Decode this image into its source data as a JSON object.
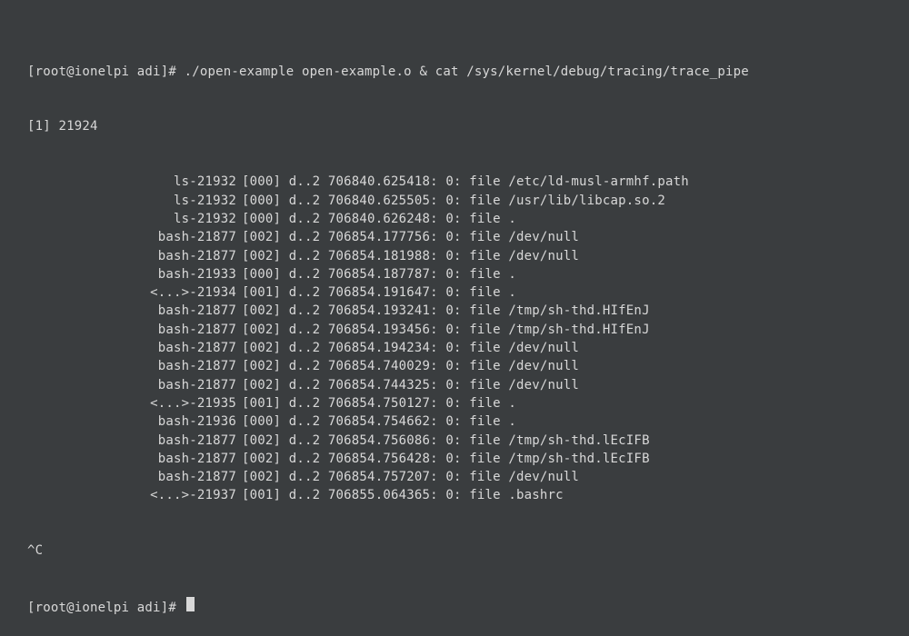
{
  "prompt1": {
    "prefix": "[root@ionelpi adi]# ",
    "cmd": "./open-example open-example.o & cat /sys/kernel/debug/tracing/trace_pipe"
  },
  "job": "[1] 21924",
  "trace": [
    {
      "proc": "ls-21932",
      "cpu": "[000]",
      "flags": "d..2",
      "ts": "706840.625418:",
      "idx": "0:",
      "label": "file",
      "path": "/etc/ld-musl-armhf.path"
    },
    {
      "proc": "ls-21932",
      "cpu": "[000]",
      "flags": "d..2",
      "ts": "706840.625505:",
      "idx": "0:",
      "label": "file",
      "path": "/usr/lib/libcap.so.2"
    },
    {
      "proc": "ls-21932",
      "cpu": "[000]",
      "flags": "d..2",
      "ts": "706840.626248:",
      "idx": "0:",
      "label": "file",
      "path": "."
    },
    {
      "proc": "bash-21877",
      "cpu": "[002]",
      "flags": "d..2",
      "ts": "706854.177756:",
      "idx": "0:",
      "label": "file",
      "path": "/dev/null"
    },
    {
      "proc": "bash-21877",
      "cpu": "[002]",
      "flags": "d..2",
      "ts": "706854.181988:",
      "idx": "0:",
      "label": "file",
      "path": "/dev/null"
    },
    {
      "proc": "bash-21933",
      "cpu": "[000]",
      "flags": "d..2",
      "ts": "706854.187787:",
      "idx": "0:",
      "label": "file",
      "path": "."
    },
    {
      "proc": "<...>-21934",
      "cpu": "[001]",
      "flags": "d..2",
      "ts": "706854.191647:",
      "idx": "0:",
      "label": "file",
      "path": "."
    },
    {
      "proc": "bash-21877",
      "cpu": "[002]",
      "flags": "d..2",
      "ts": "706854.193241:",
      "idx": "0:",
      "label": "file",
      "path": "/tmp/sh-thd.HIfEnJ"
    },
    {
      "proc": "bash-21877",
      "cpu": "[002]",
      "flags": "d..2",
      "ts": "706854.193456:",
      "idx": "0:",
      "label": "file",
      "path": "/tmp/sh-thd.HIfEnJ"
    },
    {
      "proc": "bash-21877",
      "cpu": "[002]",
      "flags": "d..2",
      "ts": "706854.194234:",
      "idx": "0:",
      "label": "file",
      "path": "/dev/null"
    },
    {
      "proc": "bash-21877",
      "cpu": "[002]",
      "flags": "d..2",
      "ts": "706854.740029:",
      "idx": "0:",
      "label": "file",
      "path": "/dev/null"
    },
    {
      "proc": "bash-21877",
      "cpu": "[002]",
      "flags": "d..2",
      "ts": "706854.744325:",
      "idx": "0:",
      "label": "file",
      "path": "/dev/null"
    },
    {
      "proc": "<...>-21935",
      "cpu": "[001]",
      "flags": "d..2",
      "ts": "706854.750127:",
      "idx": "0:",
      "label": "file",
      "path": "."
    },
    {
      "proc": "bash-21936",
      "cpu": "[000]",
      "flags": "d..2",
      "ts": "706854.754662:",
      "idx": "0:",
      "label": "file",
      "path": "."
    },
    {
      "proc": "bash-21877",
      "cpu": "[002]",
      "flags": "d..2",
      "ts": "706854.756086:",
      "idx": "0:",
      "label": "file",
      "path": "/tmp/sh-thd.lEcIFB"
    },
    {
      "proc": "bash-21877",
      "cpu": "[002]",
      "flags": "d..2",
      "ts": "706854.756428:",
      "idx": "0:",
      "label": "file",
      "path": "/tmp/sh-thd.lEcIFB"
    },
    {
      "proc": "bash-21877",
      "cpu": "[002]",
      "flags": "d..2",
      "ts": "706854.757207:",
      "idx": "0:",
      "label": "file",
      "path": "/dev/null"
    },
    {
      "proc": "<...>-21937",
      "cpu": "[001]",
      "flags": "d..2",
      "ts": "706855.064365:",
      "idx": "0:",
      "label": "file",
      "path": ".bashrc"
    }
  ],
  "interrupt": "^C",
  "prompt2": {
    "prefix": "[root@ionelpi adi]# "
  }
}
